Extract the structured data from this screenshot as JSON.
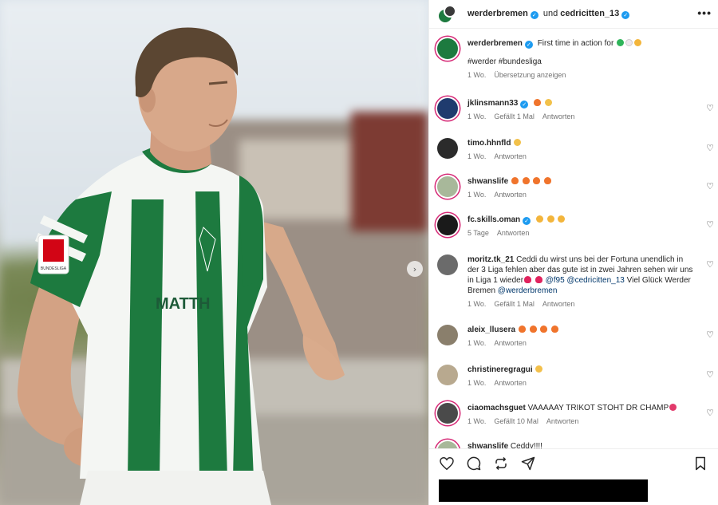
{
  "header": {
    "account1": "werderbremen",
    "connector": "und",
    "account2": "cedricitten_13",
    "more_label": "•••"
  },
  "caption": {
    "user": "werderbremen",
    "text": "First time in action for",
    "hashtags": "#werder #bundesliga",
    "time": "1 Wo.",
    "translate": "Übersetzung anzeigen"
  },
  "comments": [
    {
      "user": "jklinsmann33",
      "verified": true,
      "text": "",
      "emojis": [
        "fire",
        "hands"
      ],
      "time": "1 Wo.",
      "likes": "Gefällt 1 Mal",
      "reply": "Antworten",
      "avatar_color": "#1f3b6e"
    },
    {
      "user": "timo.hhnfld",
      "verified": false,
      "text": "",
      "emojis": [
        "hands"
      ],
      "time": "1 Wo.",
      "likes": "",
      "reply": "Antworten",
      "avatar_color": "#2b2b2b"
    },
    {
      "user": "shwanslife",
      "verified": false,
      "text": "",
      "emojis": [
        "fire",
        "fire",
        "fire",
        "fire"
      ],
      "time": "1 Wo.",
      "likes": "",
      "reply": "Antworten",
      "avatar_color": "#a8b89a"
    },
    {
      "user": "fc.skills.oman",
      "verified": true,
      "text": "",
      "emojis": [
        "clap",
        "clap",
        "clap"
      ],
      "time": "5 Tage",
      "likes": "",
      "reply": "Antworten",
      "avatar_color": "#1a1a1a"
    },
    {
      "user": "moritz.tk_21",
      "verified": false,
      "text": "Ceddi du wirst uns bei der Fortuna unendlich in der 3 Liga fehlen aber das gute ist in zwei Jahren sehen wir uns in Liga 1 wieder",
      "mention1": "@f95",
      "mention2": "@cedricitten_13",
      "text2": "Viel Glück Werder Bremen",
      "mention3": "@werderbremen",
      "time": "1 Wo.",
      "likes": "Gefällt 1 Mal",
      "reply": "Antworten",
      "avatar_color": "#6b6b6b"
    },
    {
      "user": "aleix_llusera",
      "verified": false,
      "text": "",
      "emojis": [
        "fire",
        "fire",
        "fire",
        "fire"
      ],
      "time": "1 Wo.",
      "likes": "",
      "reply": "Antworten",
      "avatar_color": "#8a7f6c"
    },
    {
      "user": "christineregragui",
      "verified": false,
      "text": "",
      "emojis": [
        "strong"
      ],
      "time": "1 Wo.",
      "likes": "",
      "reply": "Antworten",
      "avatar_color": "#b8a98f"
    },
    {
      "user": "ciaomachsguet",
      "verified": false,
      "text": "VAAAAAY TRIKOT STOHT DR CHAMP",
      "emojis": [
        "love"
      ],
      "time": "1 Wo.",
      "likes": "Gefällt 10 Mal",
      "reply": "Antworten",
      "avatar_color": "#4a4a4a"
    },
    {
      "user": "shwanslife",
      "verified": false,
      "text": "Ceddy!!!!",
      "time": "",
      "likes": "",
      "reply": "",
      "avatar_color": "#a8b89a"
    }
  ],
  "photo": {
    "sponsor": "MATTH",
    "league_badge": "BUNDESLIGA"
  },
  "colors": {
    "accent_link": "#00376b",
    "verified": "#1d9bf0",
    "jersey_green": "#1d7a3f",
    "story_ring": "#d62976"
  }
}
